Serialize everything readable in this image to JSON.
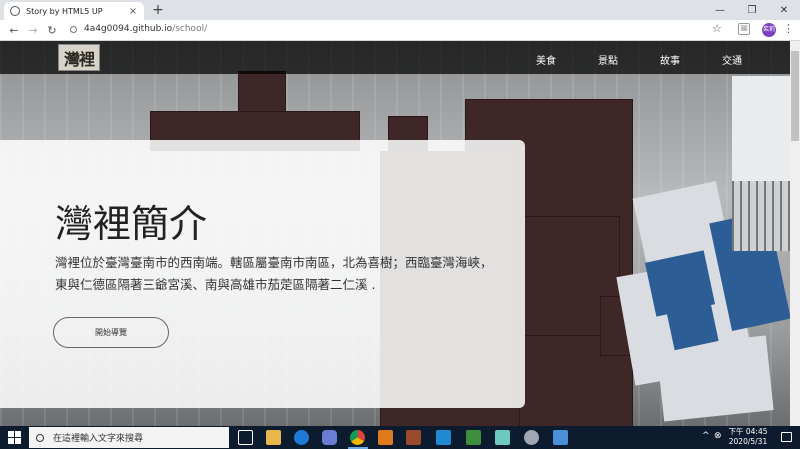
{
  "browser": {
    "tab_title": "Story by HTML5 UP",
    "tab_close": "×",
    "new_tab": "+",
    "minimize": "—",
    "restore": "❐",
    "close": "✕",
    "back": "←",
    "forward": "→",
    "reload": "↻",
    "url_host": "4a4g0094.github.io",
    "url_path": "/school/",
    "bookmark": "☆",
    "ext_label": "🖼",
    "profile": "茱莉",
    "menu": "⋮"
  },
  "site": {
    "logo_text": "灣裡",
    "nav": [
      "美食",
      "景點",
      "故事",
      "交通"
    ],
    "hero": {
      "title": "灣裡簡介",
      "text": "灣裡位於臺灣臺南市的西南端。轄區屬臺南市南區，北為喜樹；西臨臺灣海峽，東與仁德區隔著三爺宮溪、南與高雄市茄萣區隔著二仁溪 .",
      "button": "開始導覽"
    }
  },
  "taskbar": {
    "search_placeholder": "在這裡輸入文字來搜尋",
    "tray_chevron": "^",
    "tray_status": "⊗",
    "time": "下午 04:45",
    "date": "2020/5/31"
  },
  "colors": {
    "header_bg": "#000000",
    "brick": "#3e2726",
    "blue_block": "#2c5d95",
    "taskbar": "#0d1b2e",
    "profile": "#7b3fbf"
  }
}
